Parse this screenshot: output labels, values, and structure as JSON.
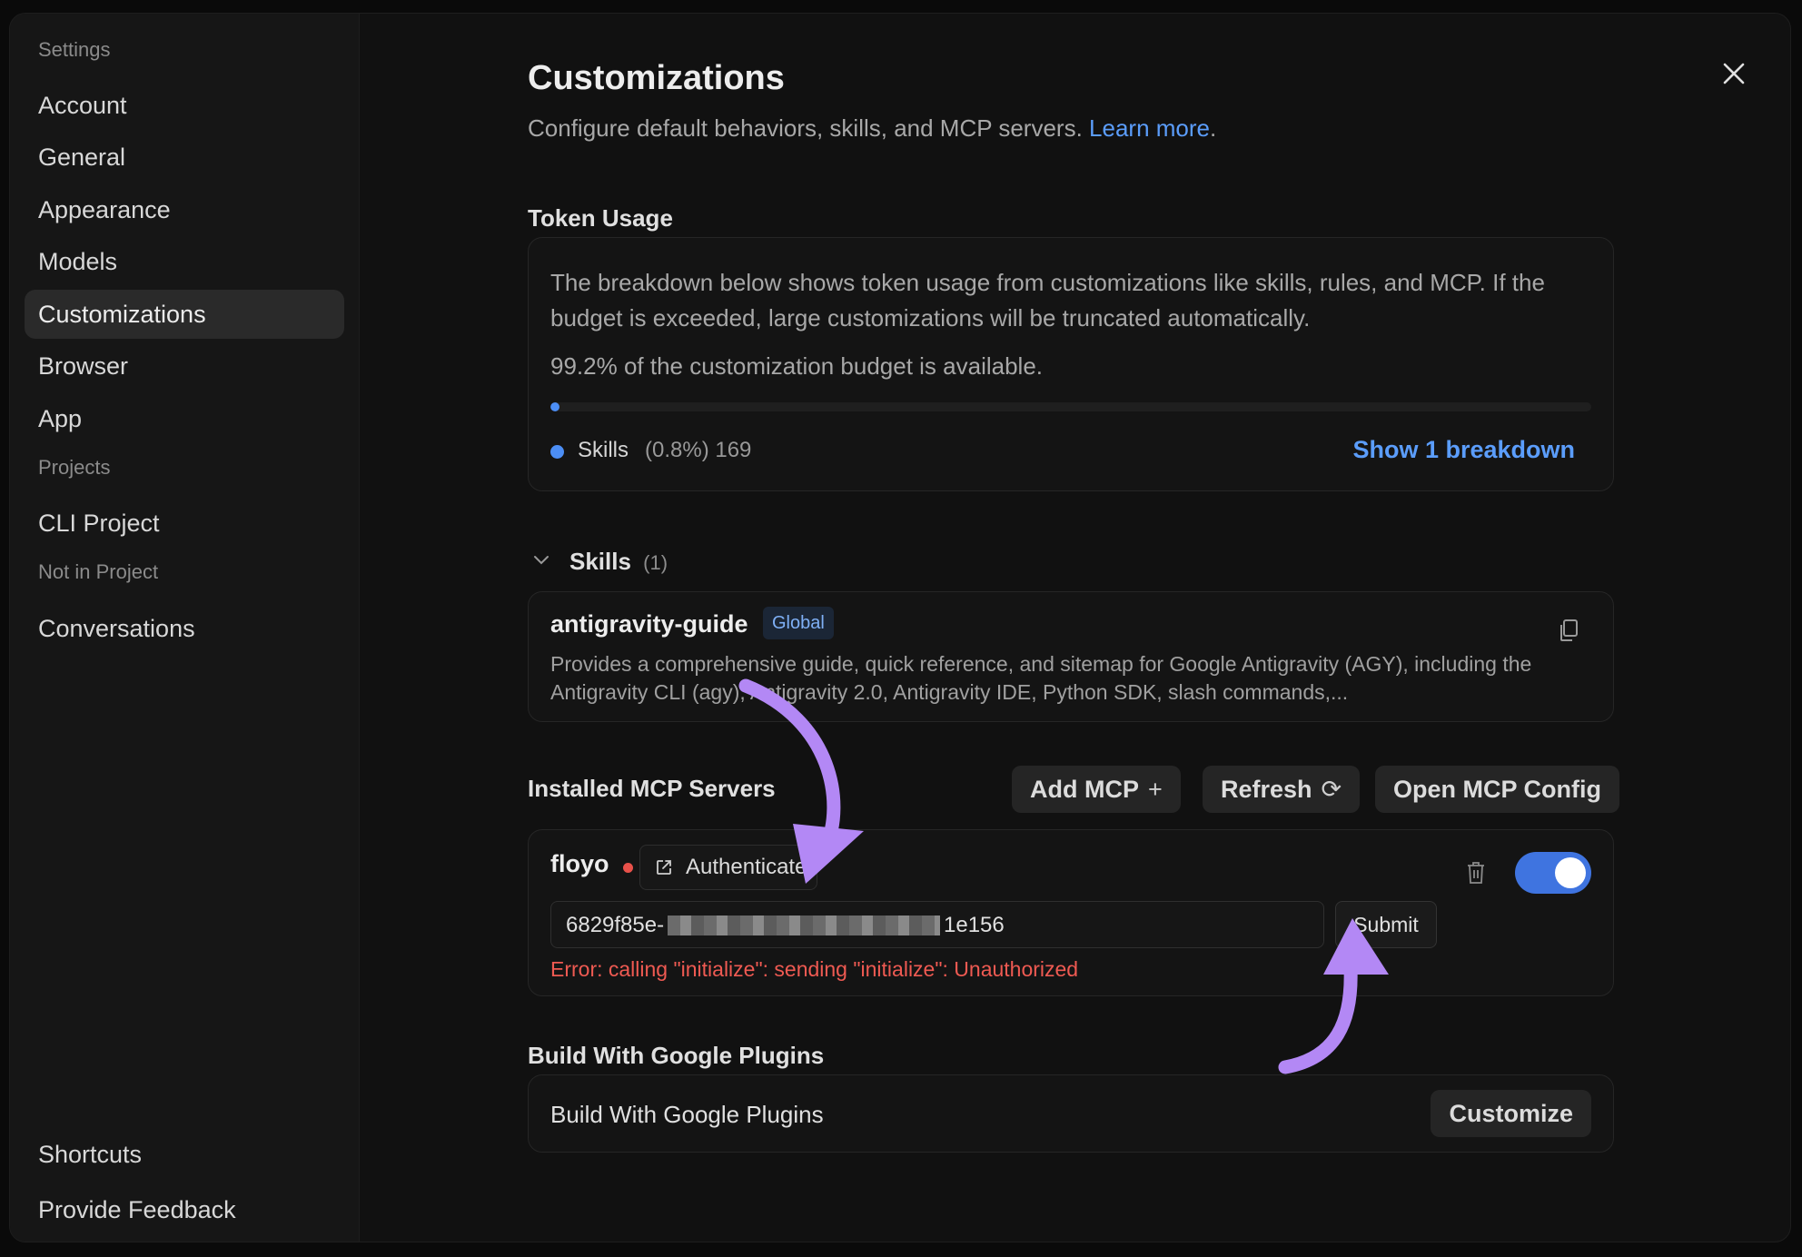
{
  "sidebar": {
    "groups": {
      "settings": "Settings",
      "projects": "Projects",
      "not_in_project": "Not in Project"
    },
    "items": [
      {
        "label": "Account"
      },
      {
        "label": "General"
      },
      {
        "label": "Appearance"
      },
      {
        "label": "Models"
      },
      {
        "label": "Customizations",
        "active": true
      },
      {
        "label": "Browser"
      },
      {
        "label": "App"
      }
    ],
    "project_items": [
      {
        "label": "CLI Project"
      }
    ],
    "other_items": [
      {
        "label": "Conversations"
      }
    ],
    "footer_items": [
      {
        "label": "Shortcuts"
      },
      {
        "label": "Provide Feedback"
      }
    ]
  },
  "header": {
    "title": "Customizations",
    "subtitle": "Configure default behaviors, skills, and MCP servers.",
    "learn_more": "Learn more",
    "subtitle_end": "."
  },
  "token_usage": {
    "title": "Token Usage",
    "description": "The breakdown below shows token usage from customizations like skills, rules, and MCP. If the budget is exceeded, large customizations will be truncated automatically.",
    "available": "99.2% of the customization budget is available.",
    "used_fraction": 0.008,
    "legend": {
      "label": "Skills",
      "meta": "(0.8%) 169",
      "color": "#4c8ef5"
    },
    "show_breakdown": "Show 1 breakdown"
  },
  "skills": {
    "title": "Skills",
    "count": "(1)",
    "items": [
      {
        "name": "antigravity-guide",
        "badge": "Global",
        "description": "Provides a comprehensive guide, quick reference, and sitemap for Google Antigravity (AGY), including the Antigravity CLI (agy), Antigravity 2.0, Antigravity IDE, Python SDK, slash commands,..."
      }
    ]
  },
  "mcp": {
    "title": "Installed MCP Servers",
    "add_label": "Add MCP",
    "add_glyph": "+",
    "refresh_label": "Refresh",
    "refresh_glyph": "⟳",
    "open_config_label": "Open MCP Config",
    "servers": [
      {
        "name": "floyo",
        "status_color": "#e8514a",
        "authenticate_label": "Authenticate",
        "token_value_start": "6829f85e-",
        "token_value_end": "1e156",
        "submit_label": "Submit",
        "error": "Error: calling \"initialize\": sending \"initialize\": Unauthorized",
        "enabled": true
      }
    ]
  },
  "plugins": {
    "title": "Build With Google Plugins",
    "label": "Build With Google Plugins",
    "customize_label": "Customize"
  },
  "colors": {
    "accent": "#5b9dfb",
    "annotation_arrow": "#b388f5",
    "error": "#ef5a52"
  }
}
